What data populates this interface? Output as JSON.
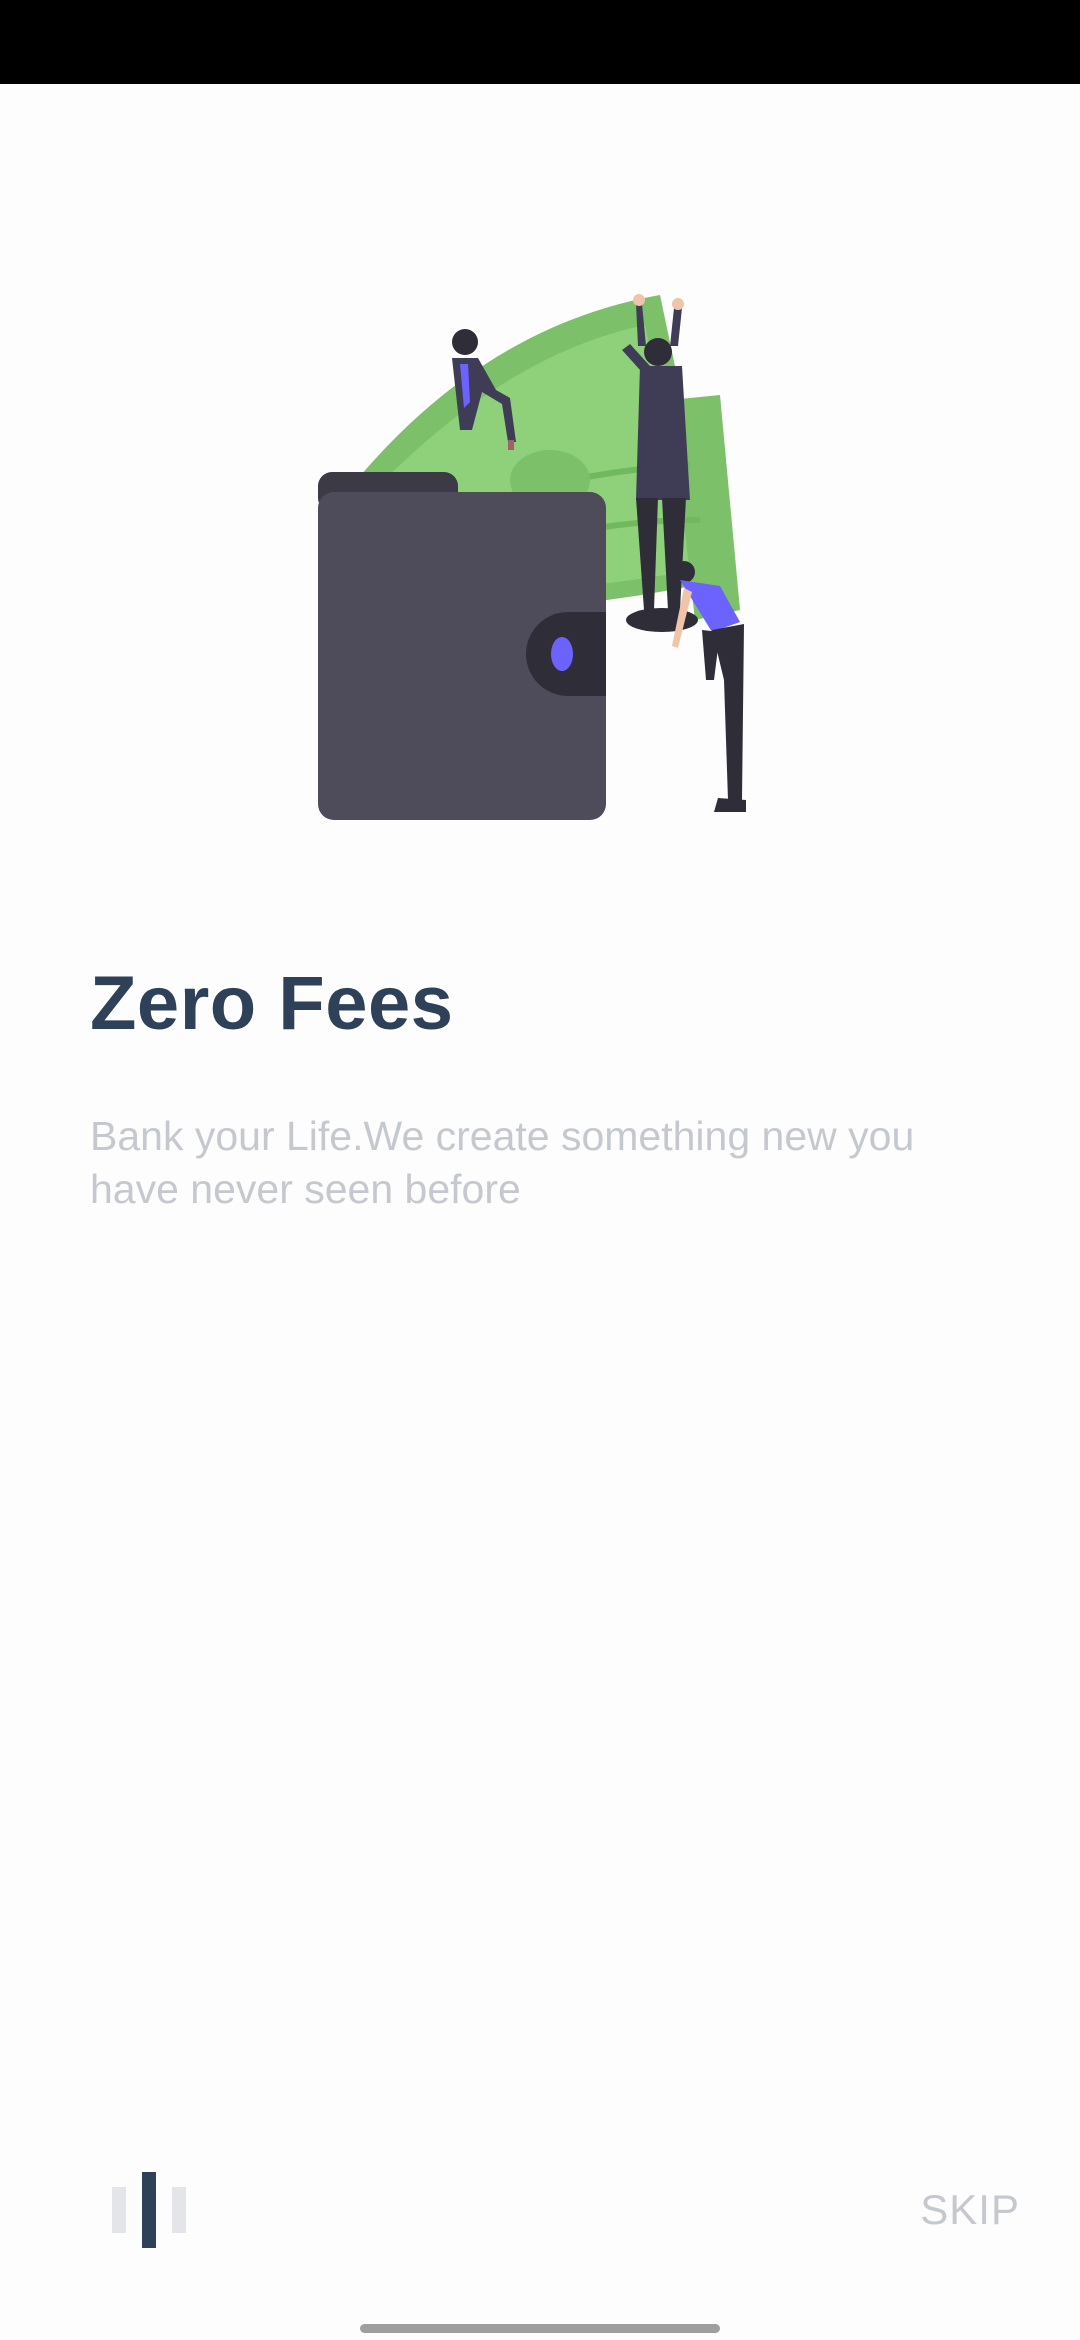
{
  "onboarding": {
    "title": "Zero Fees",
    "description": "Bank your Life.We create something new you have never seen before",
    "illustration": "wallet-money-people-illustration",
    "pages_total": 3,
    "current_page": 2
  },
  "actions": {
    "skip_label": "SKIP"
  },
  "colors": {
    "title": "#2f4158",
    "text_muted": "#c5c9cf",
    "accent_green": "#8bcb6f",
    "accent_purple": "#6c63ff",
    "wallet": "#4e4c5a",
    "background": "#fdfdfd"
  }
}
